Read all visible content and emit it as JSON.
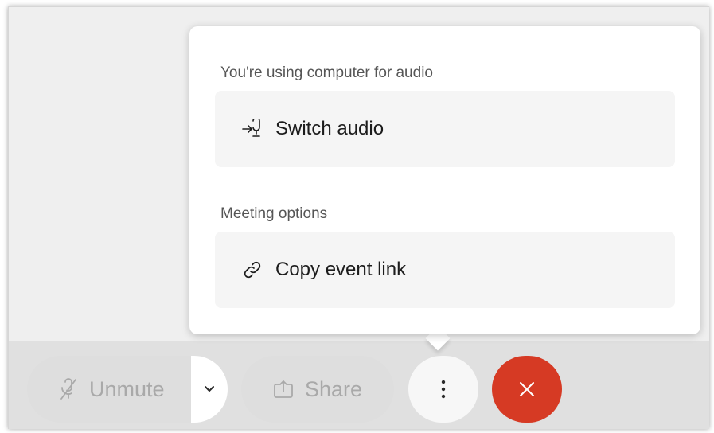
{
  "popover": {
    "audio_section_label": "You're using computer for audio",
    "switch_audio": {
      "label": "Switch audio",
      "icon": "switch-audio-icon"
    },
    "meeting_section_label": "Meeting options",
    "copy_link": {
      "label": "Copy event link",
      "icon": "link-icon"
    }
  },
  "controls": {
    "unmute": {
      "label": "Unmute",
      "icon": "microphone-muted-icon"
    },
    "audio_options": {
      "icon": "chevron-down-icon"
    },
    "share": {
      "label": "Share",
      "icon": "share-icon"
    },
    "more": {
      "icon": "more-options-icon"
    },
    "end": {
      "icon": "close-icon",
      "color": "#d63a24"
    }
  },
  "colors": {
    "background": "#efefef",
    "control_bar": "#e0e0e0",
    "disabled_text": "#a9a9a9",
    "end_call": "#d63a24"
  }
}
